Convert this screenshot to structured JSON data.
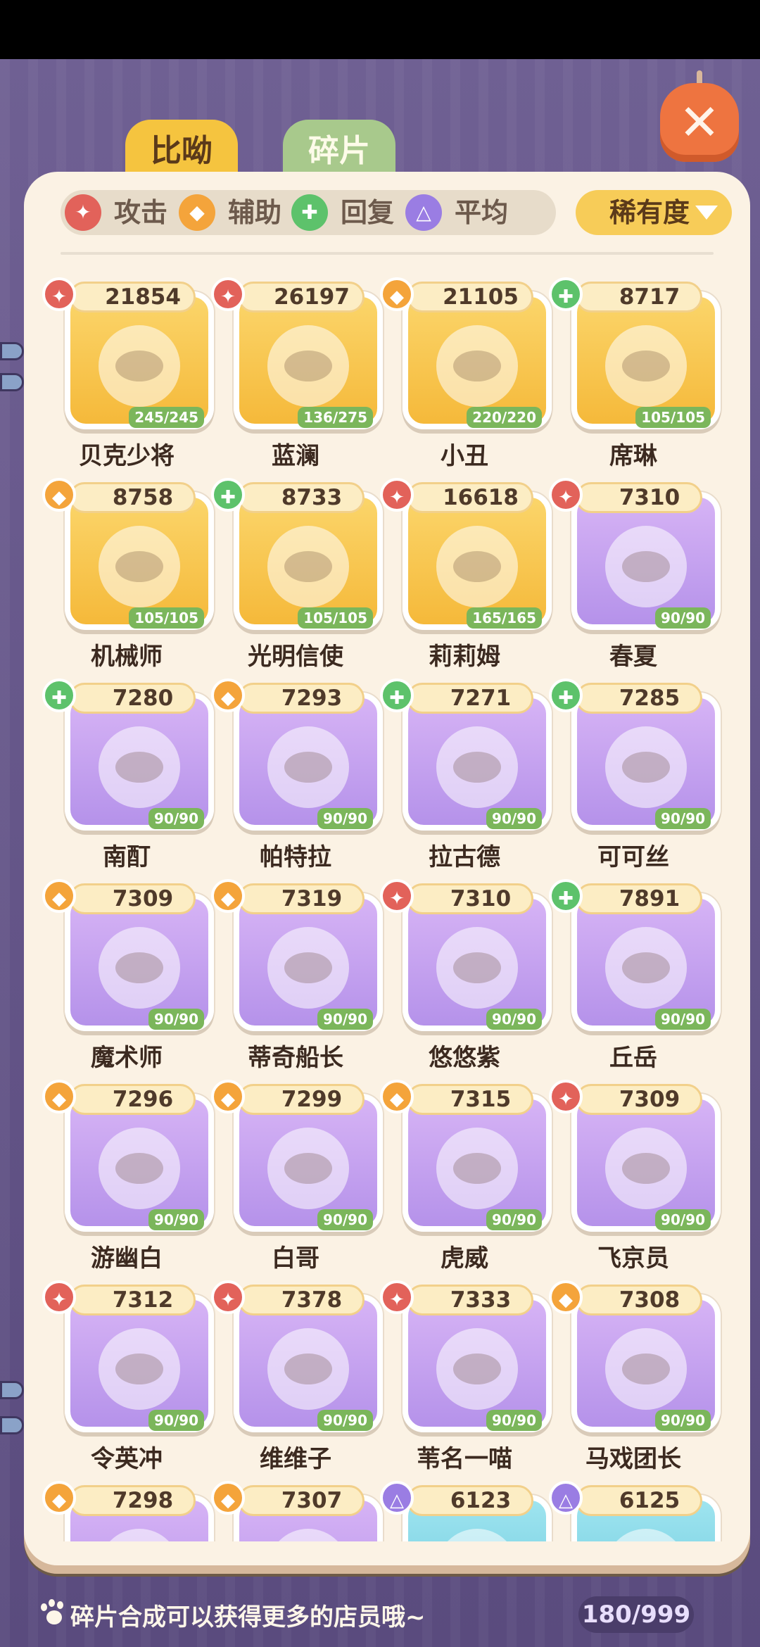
{
  "tabs": {
    "active_label": "比呦",
    "inactive_label": "碎片"
  },
  "filters": [
    {
      "label": "攻击",
      "icon": "attack-icon",
      "glyph": "✦",
      "color": "#e2625a"
    },
    {
      "label": "辅助",
      "icon": "support-icon",
      "glyph": "◆",
      "color": "#f4a43b"
    },
    {
      "label": "回复",
      "icon": "heal-icon",
      "glyph": "✚",
      "color": "#5dc26b"
    },
    {
      "label": "平均",
      "icon": "balance-icon",
      "glyph": "△",
      "color": "#9a7de3"
    }
  ],
  "sort": {
    "label": "稀有度"
  },
  "characters": [
    {
      "name": "贝克少将",
      "power": "21854",
      "role": "attack",
      "level": "245/245",
      "rarity": "gold"
    },
    {
      "name": "蓝澜",
      "power": "26197",
      "role": "attack",
      "level": "136/275",
      "rarity": "gold"
    },
    {
      "name": "小丑",
      "power": "21105",
      "role": "support",
      "level": "220/220",
      "rarity": "gold"
    },
    {
      "name": "席琳",
      "power": "8717",
      "role": "heal",
      "level": "105/105",
      "rarity": "gold"
    },
    {
      "name": "机械师",
      "power": "8758",
      "role": "support",
      "level": "105/105",
      "rarity": "gold"
    },
    {
      "name": "光明信使",
      "power": "8733",
      "role": "heal",
      "level": "105/105",
      "rarity": "gold"
    },
    {
      "name": "莉莉姆",
      "power": "16618",
      "role": "attack",
      "level": "165/165",
      "rarity": "gold"
    },
    {
      "name": "春夏",
      "power": "7310",
      "role": "attack",
      "level": "90/90",
      "rarity": "purple"
    },
    {
      "name": "南酊",
      "power": "7280",
      "role": "heal",
      "level": "90/90",
      "rarity": "purple"
    },
    {
      "name": "帕特拉",
      "power": "7293",
      "role": "support",
      "level": "90/90",
      "rarity": "purple"
    },
    {
      "name": "拉古德",
      "power": "7271",
      "role": "heal",
      "level": "90/90",
      "rarity": "purple"
    },
    {
      "name": "可可丝",
      "power": "7285",
      "role": "heal",
      "level": "90/90",
      "rarity": "purple"
    },
    {
      "name": "魔术师",
      "power": "7309",
      "role": "support",
      "level": "90/90",
      "rarity": "purple"
    },
    {
      "name": "蒂奇船长",
      "power": "7319",
      "role": "support",
      "level": "90/90",
      "rarity": "purple"
    },
    {
      "name": "悠悠紫",
      "power": "7310",
      "role": "attack",
      "level": "90/90",
      "rarity": "purple"
    },
    {
      "name": "丘岳",
      "power": "7891",
      "role": "heal",
      "level": "90/90",
      "rarity": "purple"
    },
    {
      "name": "游幽白",
      "power": "7296",
      "role": "support",
      "level": "90/90",
      "rarity": "purple"
    },
    {
      "name": "白哥",
      "power": "7299",
      "role": "support",
      "level": "90/90",
      "rarity": "purple"
    },
    {
      "name": "虎威",
      "power": "7315",
      "role": "support",
      "level": "90/90",
      "rarity": "purple"
    },
    {
      "name": "飞京员",
      "power": "7309",
      "role": "attack",
      "level": "90/90",
      "rarity": "purple"
    },
    {
      "name": "令英冲",
      "power": "7312",
      "role": "attack",
      "level": "90/90",
      "rarity": "purple"
    },
    {
      "name": "维维子",
      "power": "7378",
      "role": "attack",
      "level": "90/90",
      "rarity": "purple"
    },
    {
      "name": "苇名一喵",
      "power": "7333",
      "role": "attack",
      "level": "90/90",
      "rarity": "purple"
    },
    {
      "name": "马戏团长",
      "power": "7308",
      "role": "support",
      "level": "90/90",
      "rarity": "purple"
    },
    {
      "name": "",
      "power": "7298",
      "role": "support",
      "level": "",
      "rarity": "purple"
    },
    {
      "name": "",
      "power": "7307",
      "role": "support",
      "level": "",
      "rarity": "purple"
    },
    {
      "name": "",
      "power": "6123",
      "role": "balance",
      "level": "",
      "rarity": "cyan"
    },
    {
      "name": "",
      "power": "6125",
      "role": "balance",
      "level": "",
      "rarity": "cyan"
    }
  ],
  "role_glyphs": {
    "attack": "✦",
    "support": "◆",
    "heal": "✚",
    "balance": "△"
  },
  "footer": {
    "hint": "碎片合成可以获得更多的店员哦~",
    "count": "180/999"
  }
}
